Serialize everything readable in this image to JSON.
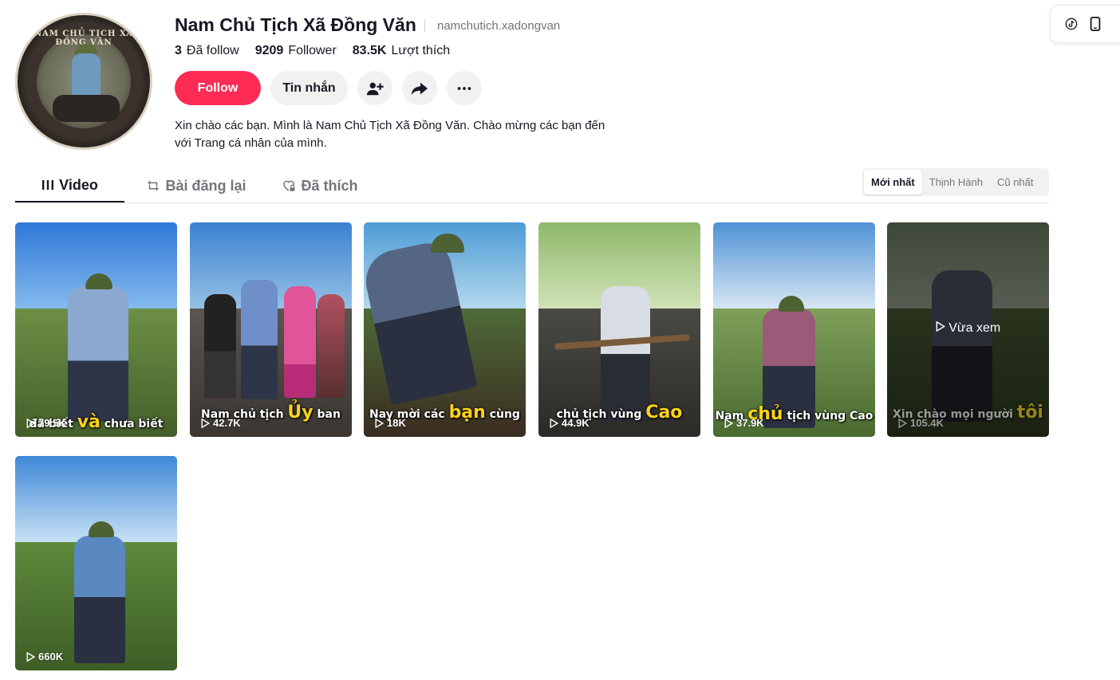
{
  "profile": {
    "avatar_ring_text": "NAM CHỦ TỊCH XÃ ĐỒNG VĂN",
    "name": "Nam Chủ Tịch Xã Đồng Văn",
    "handle": "namchutich.xadongvan",
    "stats": {
      "following_count": "3",
      "following_label": "Đã follow",
      "followers_count": "9209",
      "followers_label": "Follower",
      "likes_count": "83.5K",
      "likes_label": "Lượt thích"
    },
    "follow_label": "Follow",
    "message_label": "Tin nhắn",
    "bio_line1": "Xin chào các bạn. Mình là Nam Chủ Tịch Xã Đồng Văn. Chào mừng các bạn đến",
    "bio_line2": "với Trang cá nhân của mình."
  },
  "tabs": [
    {
      "label": "Video",
      "icon": "grid-icon",
      "active": true
    },
    {
      "label": "Bài đăng lại",
      "icon": "repost-icon",
      "active": false
    },
    {
      "label": "Đã thích",
      "icon": "heart-lock-icon",
      "active": false
    }
  ],
  "sort": [
    "Mới nhất",
    "Thịnh Hành",
    "Cũ nhất"
  ],
  "side_panel_icons": [
    "tiktok-icon",
    "mobile-icon"
  ],
  "videos": [
    {
      "views": "79.5K",
      "caption_pre": "đã biết ",
      "caption_hl": "và",
      "caption_post": " chưa biết"
    },
    {
      "views": "42.7K",
      "caption_pre": "Nam chủ tịch ",
      "caption_hl": "Ủy",
      "caption_post": " ban"
    },
    {
      "views": "18K",
      "caption_pre": "Nay mời các ",
      "caption_hl": "bạn",
      "caption_post": " cùng"
    },
    {
      "views": "44.9K",
      "caption_pre": "chủ tịch vùng ",
      "caption_hl": "Cao",
      "caption_post": ""
    },
    {
      "views": "37.9K",
      "caption_pre": "Nam ",
      "caption_hl": "chủ",
      "caption_post": " tịch vùng Cao"
    },
    {
      "views": "105.4K",
      "caption_pre": "Xin chào mọi người ",
      "caption_hl": "tôi",
      "caption_post": "",
      "watched_label": "Vừa xem"
    },
    {
      "views": "660K",
      "caption_pre": "",
      "caption_hl": "",
      "caption_post": ""
    }
  ],
  "colors": {
    "accent": "#fe2c55",
    "highlight_caption": "#ffd21a"
  }
}
